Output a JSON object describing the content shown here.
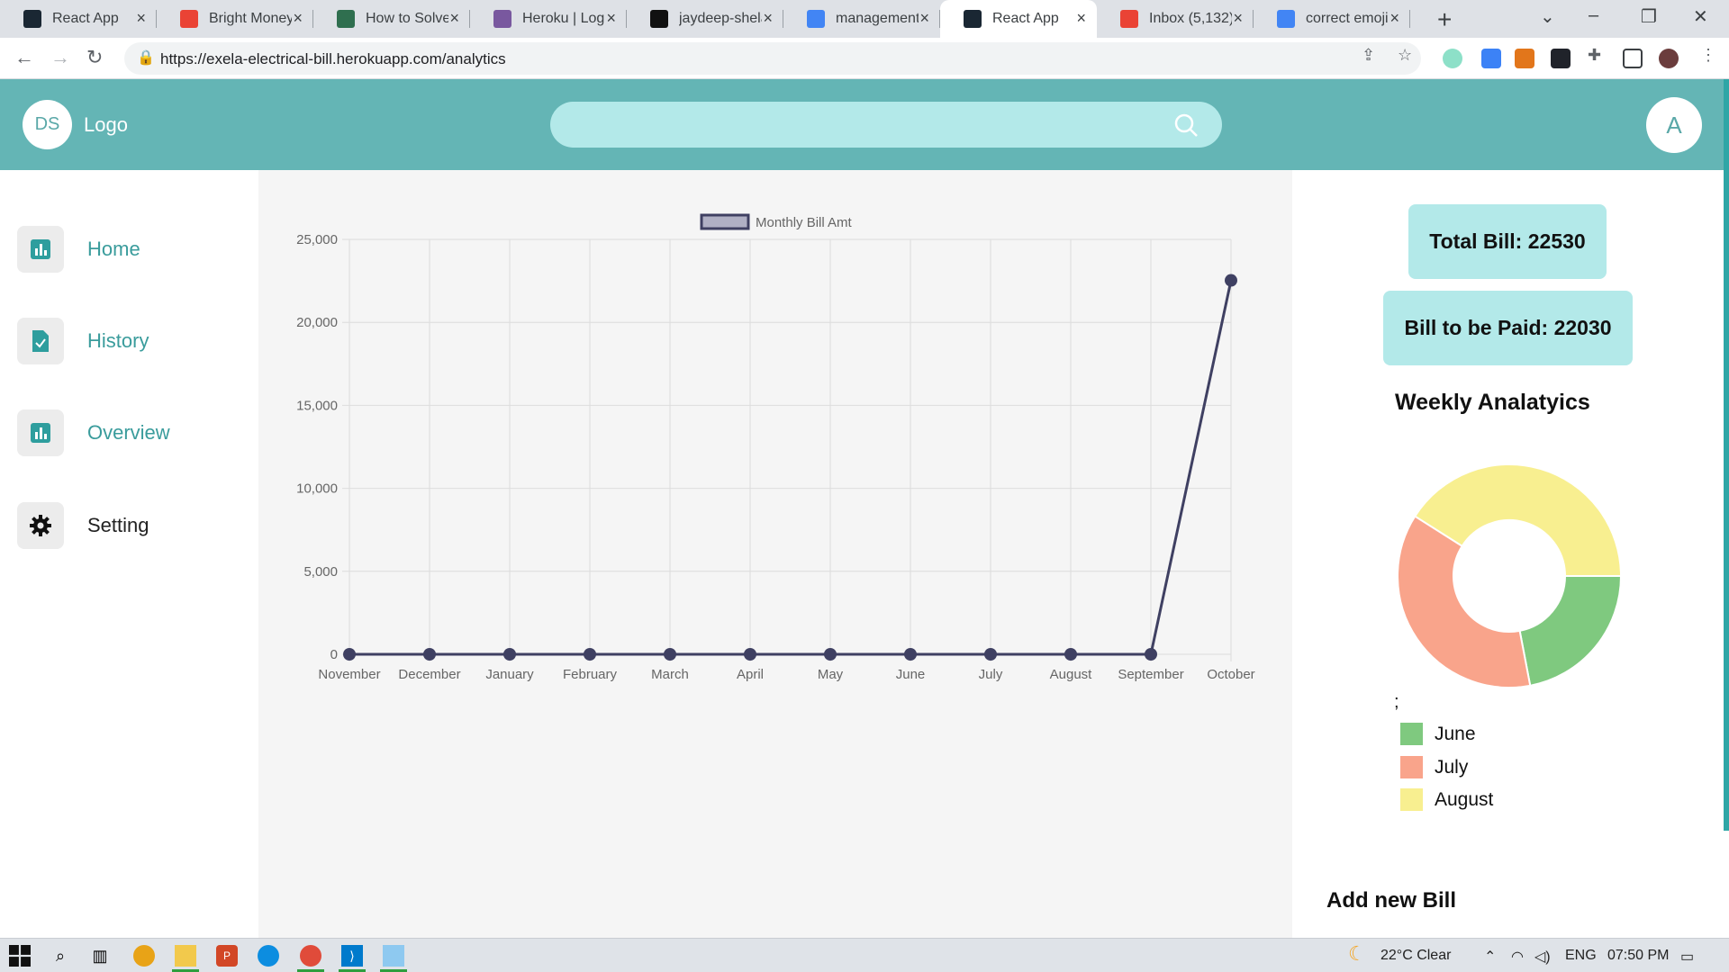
{
  "browser": {
    "tabs": [
      {
        "title": "React App",
        "icon": "react-icon",
        "color": "#1a2733"
      },
      {
        "title": "Bright Money",
        "icon": "gmail-icon",
        "color": "#ea4335"
      },
      {
        "title": "How to Solve",
        "icon": "dp-icon",
        "color": "#2f6f4f"
      },
      {
        "title": "Heroku | Login",
        "icon": "heroku-icon",
        "color": "#79589f"
      },
      {
        "title": "jaydeep-shelar",
        "icon": "github-icon",
        "color": "#111111"
      },
      {
        "title": "management",
        "icon": "google-icon",
        "color": "#4285f4"
      },
      {
        "title": "React App",
        "icon": "react-icon",
        "color": "#1a2733",
        "active": true
      },
      {
        "title": "Inbox (5,132)",
        "icon": "gmail-icon",
        "color": "#ea4335"
      },
      {
        "title": "correct emoji",
        "icon": "google-icon",
        "color": "#4285f4"
      }
    ],
    "url": "https://exela-electrical-bill.herokuapp.com/analytics"
  },
  "header": {
    "initials": "DS",
    "logo": "Logo",
    "search_placeholder": "",
    "avatar": "A"
  },
  "sidebar": {
    "items": [
      {
        "label": "Home",
        "icon": "bar-chart-icon"
      },
      {
        "label": "History",
        "icon": "document-check-icon"
      },
      {
        "label": "Overview",
        "icon": "bar-chart-icon"
      },
      {
        "label": "Setting",
        "icon": "gear-icon"
      }
    ]
  },
  "summary": {
    "total_bill": "Total Bill: 22530",
    "to_be_paid": "Bill to be Paid: 22030"
  },
  "weekly": {
    "title": "Weekly Analatyics",
    "stray": ";",
    "legend": [
      {
        "label": "June",
        "color": "#7fc97f"
      },
      {
        "label": "July",
        "color": "#f9a48b"
      },
      {
        "label": "August",
        "color": "#f8ef90"
      }
    ]
  },
  "add_new": "Add new Bill",
  "taskbar": {
    "weather": "22°C  Clear",
    "lang": "ENG",
    "time": "07:50 PM"
  },
  "chart_data": [
    {
      "type": "line",
      "legend": "Monthly Bill Amt",
      "categories": [
        "November",
        "December",
        "January",
        "February",
        "March",
        "April",
        "May",
        "June",
        "July",
        "August",
        "September",
        "October"
      ],
      "series": [
        {
          "name": "Monthly Bill Amt",
          "values": [
            0,
            0,
            0,
            0,
            0,
            0,
            0,
            0,
            0,
            0,
            0,
            22530
          ]
        }
      ],
      "ylim": [
        0,
        25000
      ],
      "yticks": [
        "0",
        "5,000",
        "10,000",
        "15,000",
        "20,000",
        "25,000"
      ],
      "grid": true,
      "line_color": "#3f4062",
      "legend_fill": "#b0b0c4"
    },
    {
      "type": "pie",
      "categories": [
        "June",
        "July",
        "August"
      ],
      "values": [
        22,
        37,
        41
      ],
      "colors": [
        "#7fc97f",
        "#f9a48b",
        "#f8ef90"
      ]
    }
  ]
}
